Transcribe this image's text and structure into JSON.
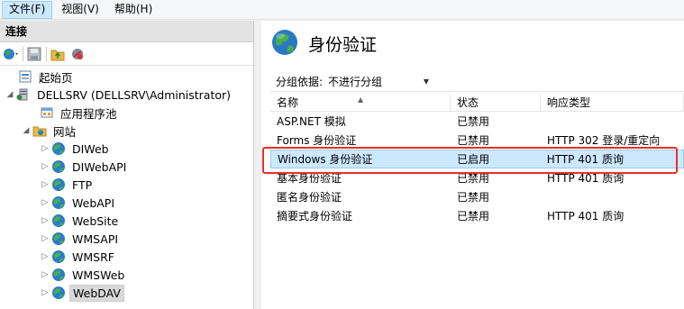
{
  "menubar": {
    "items": [
      {
        "label": "文件(F)",
        "active": true
      },
      {
        "label": "视图(V)",
        "active": false
      },
      {
        "label": "帮助(H)",
        "active": false
      }
    ]
  },
  "connections": {
    "title": "连接",
    "toolbar": [
      "back-globe-icon",
      "save-icon",
      "up-folder-icon",
      "disconnect-icon"
    ],
    "tree": [
      {
        "label": "起始页",
        "icon": "start-page-icon",
        "level": 1,
        "arrow": ""
      },
      {
        "label": "DELLSRV (DELLSRV\\Administrator)",
        "icon": "server-icon",
        "level": 0,
        "arrow": "◢"
      },
      {
        "label": "应用程序池",
        "icon": "app-pool-icon",
        "level": 2,
        "arrow": ""
      },
      {
        "label": "网站",
        "icon": "sites-folder-icon",
        "level": 1,
        "arrow": "◢"
      },
      {
        "label": "DIWeb",
        "icon": "globe-icon",
        "level": 2,
        "arrow": "▷"
      },
      {
        "label": "DIWebAPI",
        "icon": "globe-icon",
        "level": 2,
        "arrow": "▷"
      },
      {
        "label": "FTP",
        "icon": "globe-icon",
        "level": 2,
        "arrow": "▷"
      },
      {
        "label": "WebAPI",
        "icon": "globe-icon",
        "level": 2,
        "arrow": "▷"
      },
      {
        "label": "WebSite",
        "icon": "globe-icon",
        "level": 2,
        "arrow": "▷"
      },
      {
        "label": "WMSAPI",
        "icon": "globe-icon",
        "level": 2,
        "arrow": "▷"
      },
      {
        "label": "WMSRF",
        "icon": "globe-icon",
        "level": 2,
        "arrow": "▷"
      },
      {
        "label": "WMSWeb",
        "icon": "globe-icon",
        "level": 2,
        "arrow": "▷"
      },
      {
        "label": "WebDAV",
        "icon": "globe-icon",
        "level": 2,
        "arrow": "▷",
        "selected": true
      }
    ]
  },
  "main": {
    "title": "身份验证",
    "group_by_label": "分组依据:",
    "group_by_value": "不进行分组",
    "columns": [
      "名称",
      "状态",
      "响应类型"
    ],
    "rows": [
      {
        "name": "ASP.NET 模拟",
        "status": "已禁用",
        "response": ""
      },
      {
        "name": "Forms 身份验证",
        "status": "已禁用",
        "response": "HTTP 302 登录/重定向"
      },
      {
        "name": "Windows 身份验证",
        "status": "已启用",
        "response": "HTTP 401 质询",
        "selected": true
      },
      {
        "name": "基本身份验证",
        "status": "已禁用",
        "response": "HTTP 401 质询"
      },
      {
        "name": "匿名身份验证",
        "status": "已禁用",
        "response": ""
      },
      {
        "name": "摘要式身份验证",
        "status": "已禁用",
        "response": "HTTP 401 质询"
      }
    ]
  }
}
